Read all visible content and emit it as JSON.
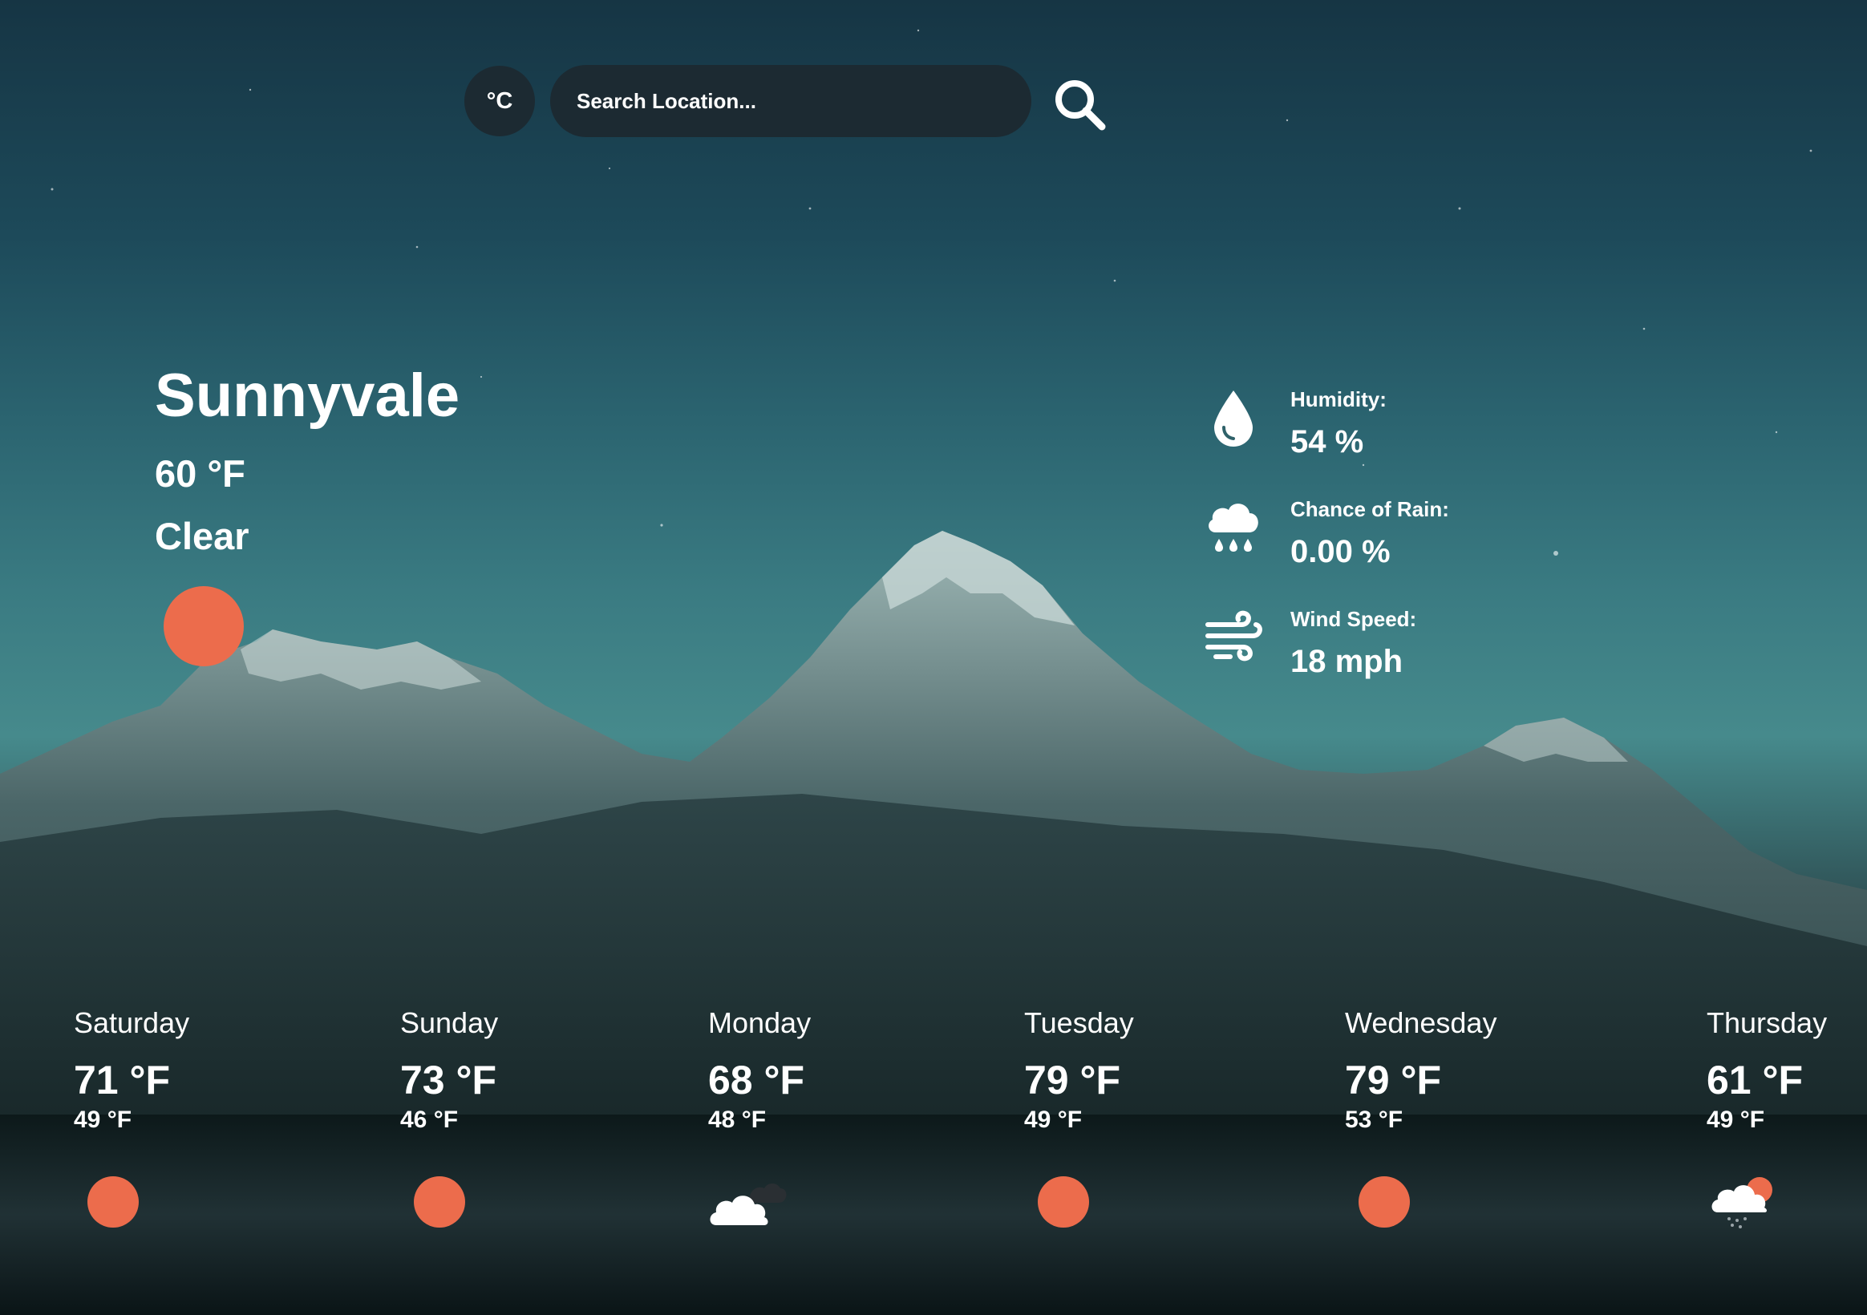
{
  "header": {
    "unit_toggle_label": "°C",
    "search_placeholder": "Search Location...",
    "search_value": ""
  },
  "current": {
    "city": "Sunnyvale",
    "temperature": "60 °F",
    "condition": "Clear",
    "icon": "sun-icon"
  },
  "stats": [
    {
      "label": "Humidity:",
      "value": "54 %",
      "icon": "water-drop-icon"
    },
    {
      "label": "Chance of Rain:",
      "value": "0.00 %",
      "icon": "rain-cloud-icon"
    },
    {
      "label": "Wind Speed:",
      "value": "18 mph",
      "icon": "wind-icon"
    }
  ],
  "forecast": [
    {
      "day": "Saturday",
      "high": "71 °F",
      "low": "49 °F",
      "icon": "sun-icon"
    },
    {
      "day": "Sunday",
      "high": "73 °F",
      "low": "46 °F",
      "icon": "sun-icon"
    },
    {
      "day": "Monday",
      "high": "68 °F",
      "low": "48 °F",
      "icon": "cloudy-icon"
    },
    {
      "day": "Tuesday",
      "high": "79 °F",
      "low": "49 °F",
      "icon": "sun-icon"
    },
    {
      "day": "Wednesday",
      "high": "79 °F",
      "low": "53 °F",
      "icon": "sun-icon"
    },
    {
      "day": "Thursday",
      "high": "61 °F",
      "low": "49 °F",
      "icon": "cloud-sun-rain-icon"
    }
  ],
  "colors": {
    "sun": "#ec6c4c",
    "control_bg": "#1c2a32"
  }
}
